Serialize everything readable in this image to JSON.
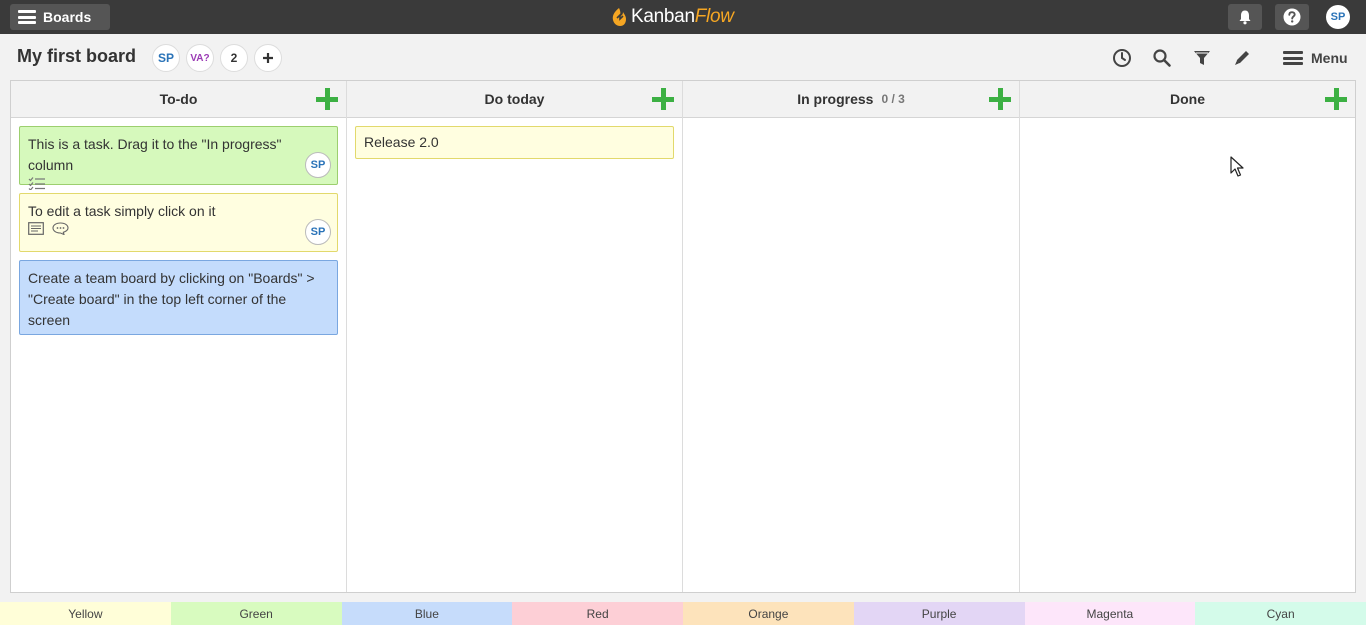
{
  "topbar": {
    "boards_label": "Boards",
    "logo_part1": "Kanban",
    "logo_part2": "Flow",
    "user_initials": "SP"
  },
  "board": {
    "title": "My first board",
    "members": [
      {
        "initials": "SP",
        "color": "#2a73b8"
      },
      {
        "initials": "VA?",
        "color": "#9b3bb5"
      }
    ],
    "member_count": "2",
    "menu_label": "Menu"
  },
  "columns": [
    {
      "name": "To-do",
      "wip": "",
      "tasks": [
        {
          "text": "This is a task. Drag it to the \"In progress\" column",
          "color": "green",
          "avatar": "SP",
          "icons": [
            "subtasks-icon"
          ]
        },
        {
          "text": "To edit a task simply click on it",
          "color": "yellow",
          "avatar": "SP",
          "icons": [
            "description-icon",
            "comment-icon"
          ]
        },
        {
          "text": "Create a team board by clicking on \"Boards\" > \"Create board\" in the top left corner of the screen",
          "color": "blue",
          "avatar": "",
          "icons": []
        }
      ]
    },
    {
      "name": "Do today",
      "wip": "",
      "tasks": [
        {
          "text": "Release 2.0",
          "color": "yellow",
          "avatar": "",
          "icons": []
        }
      ]
    },
    {
      "name": "In progress",
      "wip": "0 / 3",
      "tasks": []
    },
    {
      "name": "Done",
      "wip": "",
      "tasks": []
    }
  ],
  "colors": [
    {
      "label": "Yellow",
      "hex": "#fffed8"
    },
    {
      "label": "Green",
      "hex": "#d8fbbf"
    },
    {
      "label": "Blue",
      "hex": "#c6dcfb"
    },
    {
      "label": "Red",
      "hex": "#fdcfd6"
    },
    {
      "label": "Orange",
      "hex": "#fde3bb"
    },
    {
      "label": "Purple",
      "hex": "#e3d6f5"
    },
    {
      "label": "Magenta",
      "hex": "#fde6fa"
    },
    {
      "label": "Cyan",
      "hex": "#d4fbea"
    }
  ]
}
